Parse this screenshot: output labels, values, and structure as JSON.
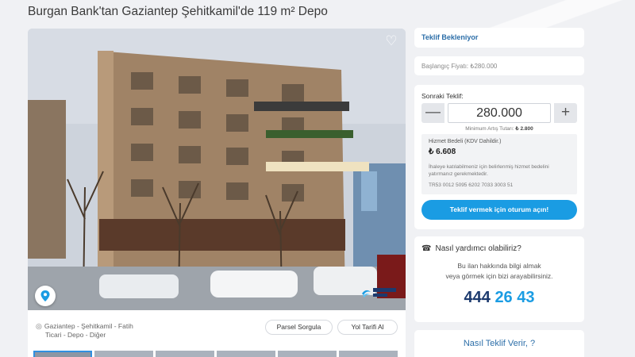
{
  "page": {
    "title": "Burgan Bank'tan Gaziantep Şehitkamil'de 119 m² Depo"
  },
  "listing": {
    "photo_alt": "Building photo",
    "location_line": "Gaziantep - Şehitkamil - Fatih",
    "category_line": "Ticari - Depo - Diğer",
    "parcel_button": "Parsel Sorgula",
    "directions_button": "Yol Tarifi Al",
    "thumbnail_count": 6
  },
  "bid": {
    "status": "Teklif Bekleniyor",
    "starting_price": "Başlangıç Fiyatı: ₺280.000",
    "next_bid_label": "Sonraki Teklif:",
    "next_bid_value": "280.000",
    "minus_label": "—",
    "plus_label": "+",
    "min_increment_label": "Minimum Artış Tutarı: ",
    "min_increment_value": "₺ 2.800",
    "fee_title": "Hizmet Bedeli (KDV Dahildir.)",
    "fee_amount": "₺ 6.608",
    "fee_note": "İhaleye katılabilmeniz için belirlenmiş hizmet bedelini yatırmanız gerekmektedir.",
    "iban": "TR53 0012 5095 6202 7033 3003 51",
    "login_button": "Teklif vermek için oturum açın!"
  },
  "help": {
    "heading": "Nasıl yardımcı olabiliriz?",
    "description_line1": "Bu ilan hakkında bilgi almak",
    "description_line2": "veya görmek için bizi arayabilirsiniz.",
    "phone_part1": "444",
    "phone_part2": "26 43"
  },
  "howto": {
    "label": "Nasıl Teklif Verir, ?"
  },
  "colors": {
    "accent": "#1a9ce3",
    "navy": "#1c3a6e",
    "status_blue": "#2c6ea8"
  }
}
